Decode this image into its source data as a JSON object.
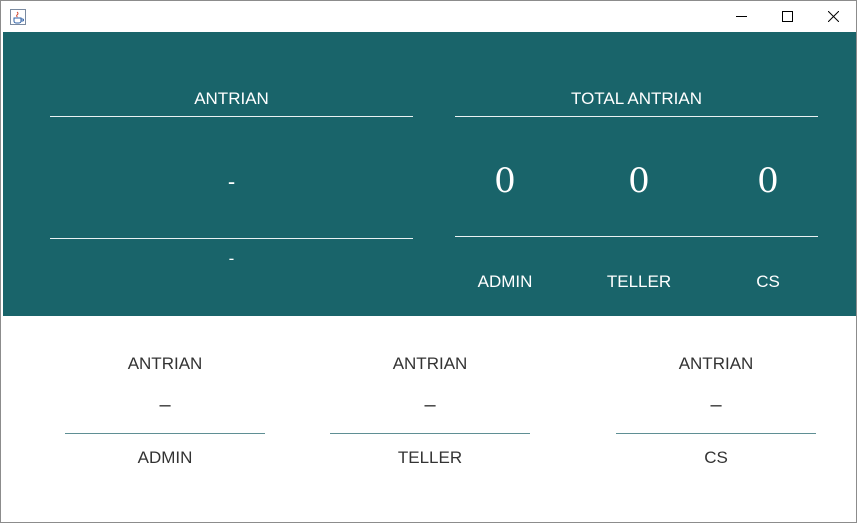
{
  "window": {
    "title": "",
    "icon": "java-cup-icon",
    "controls": [
      "minimize-icon",
      "maximize-icon",
      "close-icon"
    ]
  },
  "top_panel": {
    "current": {
      "header": "ANTRIAN",
      "number": "-",
      "sub": "-"
    },
    "total": {
      "header": "TOTAL ANTRIAN",
      "counts": [
        {
          "value": "0",
          "label": "ADMIN"
        },
        {
          "value": "0",
          "label": "TELLER"
        },
        {
          "value": "0",
          "label": "CS"
        }
      ]
    },
    "background": "#19646a"
  },
  "counters": [
    {
      "header": "ANTRIAN",
      "number": "–",
      "label": "ADMIN"
    },
    {
      "header": "ANTRIAN",
      "number": "–",
      "label": "TELLER"
    },
    {
      "header": "ANTRIAN",
      "number": "–",
      "label": "CS"
    }
  ]
}
